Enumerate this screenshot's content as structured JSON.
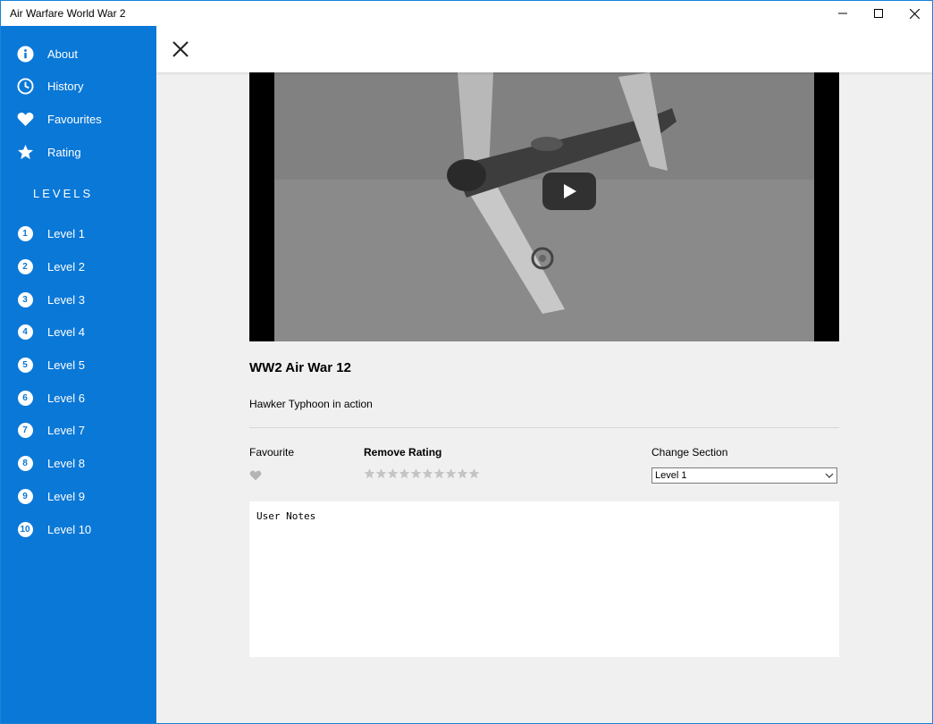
{
  "window": {
    "title": "Air Warfare World War 2"
  },
  "sidebar": {
    "items": [
      {
        "label": "About",
        "icon": "info-icon"
      },
      {
        "label": "History",
        "icon": "clock-icon"
      },
      {
        "label": "Favourites",
        "icon": "heart-icon"
      },
      {
        "label": "Rating",
        "icon": "star-icon"
      }
    ],
    "levels_heading": "LEVELS",
    "levels": [
      {
        "num": "1",
        "label": "Level 1"
      },
      {
        "num": "2",
        "label": "Level 2"
      },
      {
        "num": "3",
        "label": "Level 3"
      },
      {
        "num": "4",
        "label": "Level 4"
      },
      {
        "num": "5",
        "label": "Level 5"
      },
      {
        "num": "6",
        "label": "Level 6"
      },
      {
        "num": "7",
        "label": "Level 7"
      },
      {
        "num": "8",
        "label": "Level 8"
      },
      {
        "num": "9",
        "label": "Level 9"
      },
      {
        "num": "10",
        "label": "Level 10"
      }
    ]
  },
  "video": {
    "title": "WW2 Air War 12",
    "description": "Hawker Typhoon in action"
  },
  "controls": {
    "favourite_label": "Favourite",
    "rating_label": "Remove Rating",
    "rating_value": 0,
    "rating_max": 10,
    "section_label": "Change Section",
    "section_value": "Level 1"
  },
  "notes": {
    "placeholder": "User Notes"
  },
  "colors": {
    "accent": "#0a78d7",
    "content_bg": "#f0f0f0"
  }
}
